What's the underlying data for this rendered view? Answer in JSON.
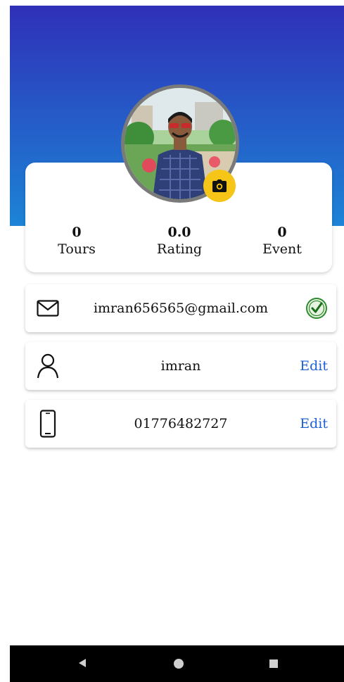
{
  "profile": {
    "avatar_alt": "profile photo",
    "camera_icon": "camera-icon"
  },
  "stats": [
    {
      "value": "0",
      "label": "Tours"
    },
    {
      "value": "0.0",
      "label": "Rating"
    },
    {
      "value": "0",
      "label": "Event"
    }
  ],
  "info": {
    "email": "imran656565@gmail.com",
    "email_icon": "mail-icon",
    "verified_icon": "verified-check-icon",
    "name": "imran",
    "name_icon": "person-icon",
    "name_edit": "Edit",
    "phone": "01776482727",
    "phone_icon": "phone-icon",
    "phone_edit": "Edit"
  },
  "colors": {
    "header_top": "#2f30b8",
    "header_bottom": "#1c84d6",
    "accent_yellow": "#f5c518",
    "edit_blue": "#1a5fd6",
    "verified_green": "#2e8b2e"
  },
  "navbar": {
    "back_icon": "back-triangle-icon",
    "home_icon": "home-circle-icon",
    "recents_icon": "recents-square-icon"
  }
}
